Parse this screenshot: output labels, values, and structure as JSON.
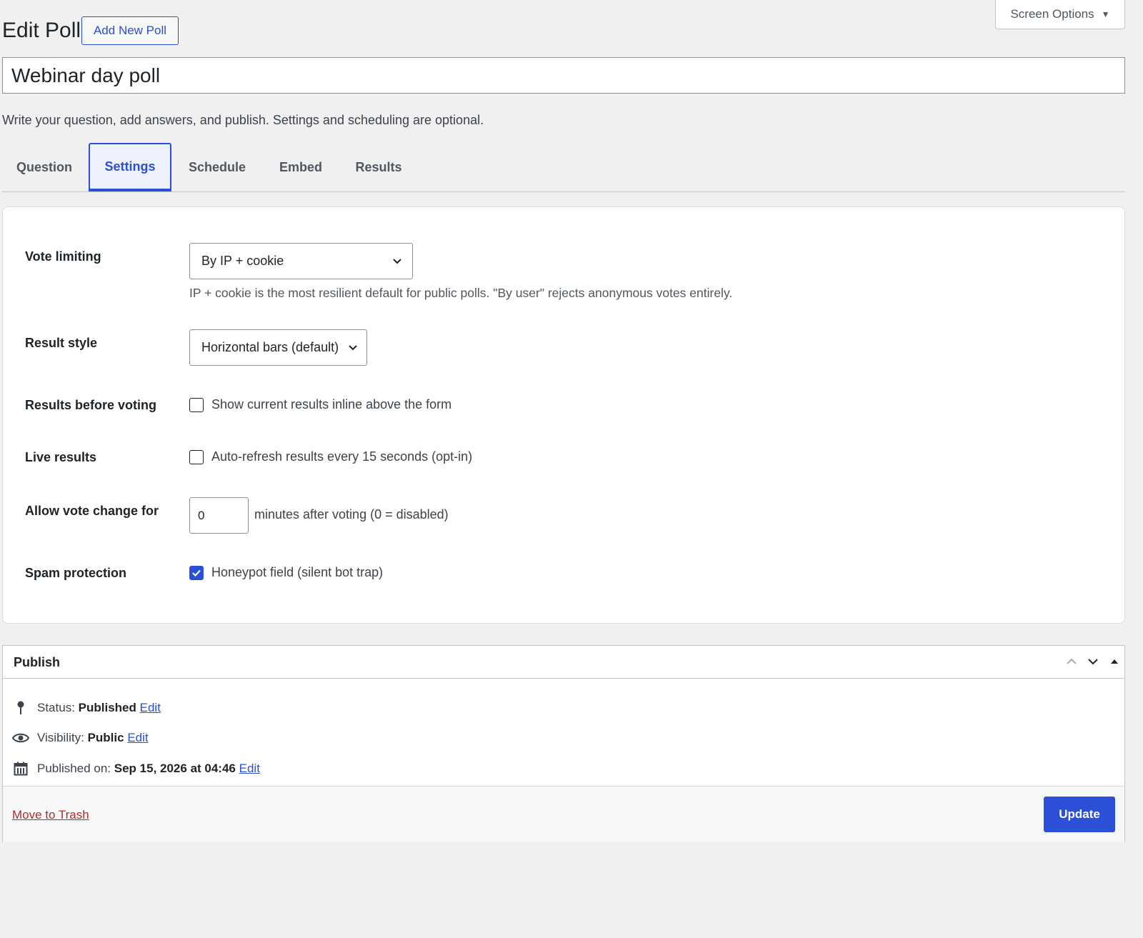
{
  "screen_options": {
    "label": "Screen Options",
    "icon": "caret-down-icon"
  },
  "header": {
    "title": "Edit Poll",
    "add_new_label": "Add New Poll"
  },
  "poll_title": {
    "value": "Webinar day poll"
  },
  "helper_text": "Write your question, add answers, and publish. Settings and scheduling are optional.",
  "tabs": [
    {
      "label": "Question",
      "active": false
    },
    {
      "label": "Settings",
      "active": true
    },
    {
      "label": "Schedule",
      "active": false
    },
    {
      "label": "Embed",
      "active": false
    },
    {
      "label": "Results",
      "active": false
    }
  ],
  "settings": {
    "vote_limiting": {
      "label": "Vote limiting",
      "selected": "By IP + cookie",
      "description": "IP + cookie is the most resilient default for public polls. \"By user\" rejects anonymous votes entirely."
    },
    "result_style": {
      "label": "Result style",
      "selected": "Horizontal bars (default)"
    },
    "results_before_voting": {
      "label": "Results before voting",
      "checkbox_label": "Show current results inline above the form",
      "checked": false
    },
    "live_results": {
      "label": "Live results",
      "checkbox_label": "Auto-refresh results every 15 seconds (opt-in)",
      "checked": false
    },
    "allow_vote_change": {
      "label": "Allow vote change for",
      "value": "0",
      "suffix": "minutes after voting (0 = disabled)"
    },
    "spam_protection": {
      "label": "Spam protection",
      "checkbox_label": "Honeypot field (silent bot trap)",
      "checked": true
    }
  },
  "publish": {
    "title": "Publish",
    "status_label": "Status:",
    "status_value": "Published",
    "visibility_label": "Visibility:",
    "visibility_value": "Public",
    "published_on_label": "Published on:",
    "published_on_value": "Sep 15, 2026 at 04:46",
    "edit_label": "Edit",
    "trash_label": "Move to Trash",
    "update_label": "Update"
  },
  "colors": {
    "accent": "#2c4fd7",
    "background": "#f0f0f1",
    "danger": "#b32d2e"
  }
}
